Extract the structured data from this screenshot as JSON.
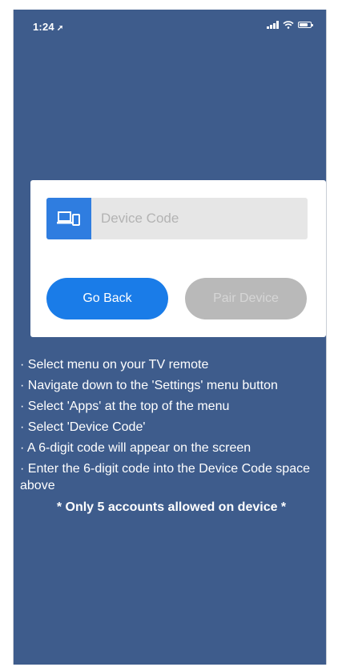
{
  "status_bar": {
    "time": "1:24",
    "location_glyph": "➚",
    "icons": [
      "signal-icon",
      "wifi-icon",
      "battery-icon"
    ]
  },
  "pairing_card": {
    "device_icon": "device-pair-icon",
    "code_field": {
      "placeholder": "Device Code",
      "value": ""
    },
    "go_back_label": "Go Back",
    "pair_device_label": "Pair Device"
  },
  "instructions": {
    "steps": [
      "· Select menu on your TV remote",
      "· Navigate down to the 'Settings' menu button",
      "· Select 'Apps' at the top of the menu",
      "· Select 'Device Code'",
      "· A 6-digit code will appear on the screen",
      "· Enter the 6-digit code into the Device Code space above"
    ],
    "note": "* Only 5 accounts allowed on device *"
  },
  "colors": {
    "background": "#3e5c8c",
    "accent": "#1a7ce8",
    "disabled": "#b9b9b9"
  }
}
